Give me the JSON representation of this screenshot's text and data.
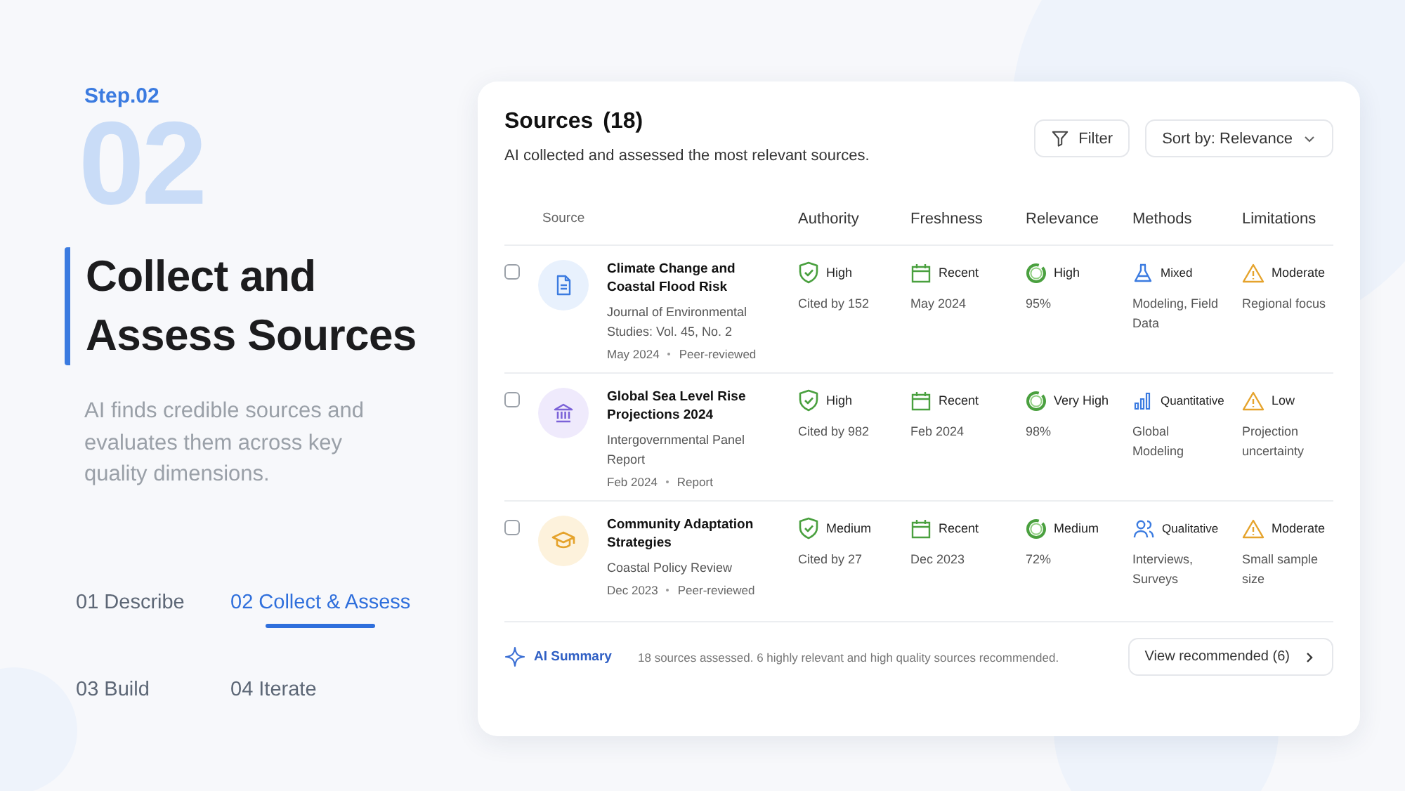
{
  "intro": {
    "step": "Step.02",
    "big_number": "02",
    "title": "Collect and Assess Sources",
    "description": "AI finds credible sources and evaluates them across key quality dimensions."
  },
  "steps": [
    {
      "label": "01 Describe",
      "selected": false
    },
    {
      "label": "02 Collect & Assess",
      "selected": true
    },
    {
      "label": "03 Build",
      "selected": false
    },
    {
      "label": "04 Iterate",
      "selected": false
    }
  ],
  "panel": {
    "title": "Sources",
    "count": "(18)",
    "subtitle": "AI collected and assessed the most relevant sources.",
    "filter_button": "Filter",
    "sort_button": "Sort by: Relevance",
    "columns": [
      "Source",
      "Authority",
      "Freshness",
      "Relevance",
      "Methods",
      "Limitations"
    ],
    "rows": [
      {
        "checked": false,
        "kind": "document",
        "title": "Climate Change and Coastal Flood Risk",
        "publisher": "Journal of Environmental Studies: Vol. 45, No. 2",
        "date": "May 2024",
        "type": "Peer-reviewed",
        "authority": "High",
        "citations": "Cited by 152",
        "freshness": "Recent",
        "published": "May 2024",
        "relevance": "High",
        "score": "95%",
        "method": {
          "kind": "lab",
          "label": "Mixed",
          "detail": "Modeling, Field Data"
        },
        "limitation": "Moderate",
        "limitation_detail": "Regional focus"
      },
      {
        "checked": false,
        "kind": "institution",
        "title": "Global Sea Level Rise Projections 2024",
        "publisher": "Intergovernmental Panel Report",
        "date": "Feb 2024",
        "type": "Report",
        "authority": "High",
        "citations": "Cited by 982",
        "freshness": "Recent",
        "published": "Feb 2024",
        "relevance": "Very High",
        "score": "98%",
        "method": {
          "kind": "chart",
          "label": "Quantitative",
          "detail": "Global Modeling"
        },
        "limitation": "Low",
        "limitation_detail": "Projection uncertainty"
      },
      {
        "checked": false,
        "kind": "academic",
        "title": "Community Adaptation Strategies",
        "publisher": "Coastal Policy Review",
        "date": "Dec 2023",
        "type": "Peer-reviewed",
        "authority": "Medium",
        "citations": "Cited by 27",
        "freshness": "Recent",
        "published": "Dec 2023",
        "relevance": "Medium",
        "score": "72%",
        "method": {
          "kind": "people",
          "label": "Qualitative",
          "detail": "Interviews, Surveys"
        },
        "limitation": "Moderate",
        "limitation_detail": "Small sample size"
      }
    ],
    "summary_label": "AI Summary",
    "summary": "18 sources assessed. 6 highly relevant and high quality sources recommended.",
    "recommend_button": "View recommended (6)"
  }
}
